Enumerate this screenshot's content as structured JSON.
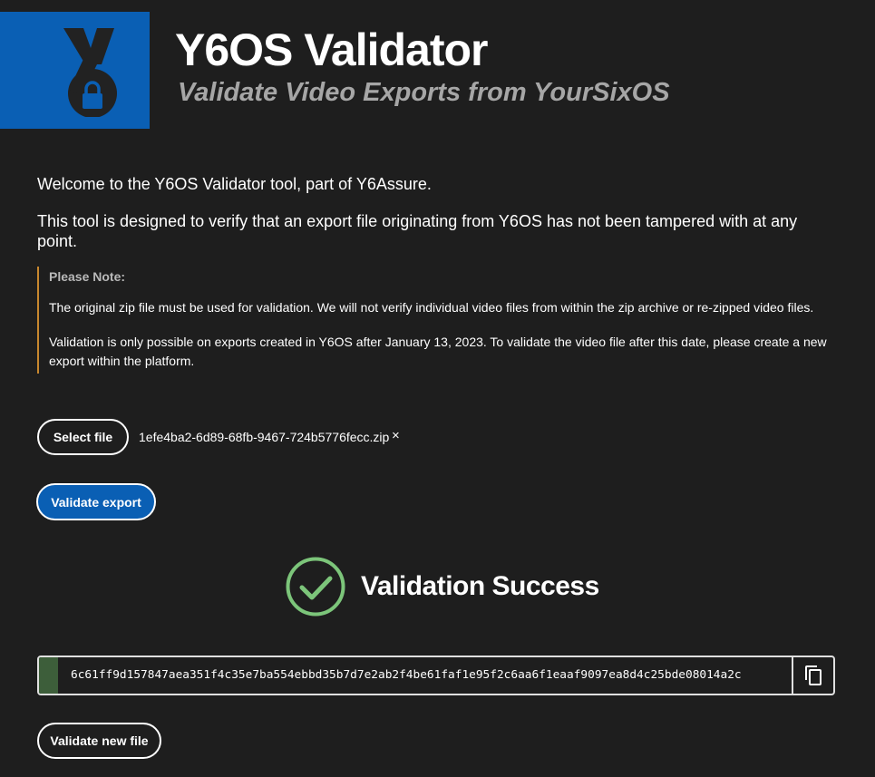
{
  "header": {
    "title": "Y6OS Validator",
    "subtitle": "Validate Video Exports from YourSixOS",
    "logo_icon": "y6-lock-logo-icon",
    "brand_color": "#0a5fb4"
  },
  "intro": {
    "welcome": "Welcome to the Y6OS Validator tool, part of Y6Assure.",
    "description": "This tool is designed to verify that an export file originating from Y6OS has not been tampered with at any point."
  },
  "note": {
    "title": "Please Note:",
    "paragraph1": "The original zip file must be used for validation. We will not verify individual video files from within the zip archive or re-zipped video files.",
    "paragraph2": "Validation is only possible on exports created in Y6OS after January 13, 2023. To validate the video file after this date, please create a new export within the platform.",
    "accent_color": "#c8872e"
  },
  "file": {
    "select_label": "Select file",
    "selected_name": "1efe4ba2-6d89-68fb-9467-724b5776fecc.zip",
    "remove_icon": "×"
  },
  "actions": {
    "validate_label": "Validate export",
    "validate_new_label": "Validate new file"
  },
  "result": {
    "status": "Validation Success",
    "status_color": "#7cc57a",
    "hash": "6c61ff9d157847aea351f4c35e7ba554ebbd35b7d7e2ab2f4be61faf1e95f2c6aa6f1eaaf9097ea8d4c25bde08014a2c",
    "copy_icon": "copy-icon"
  }
}
